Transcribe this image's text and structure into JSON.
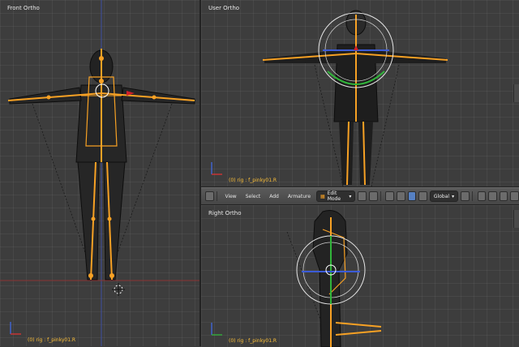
{
  "front": {
    "title": "Front Ortho",
    "status": "(0) rig : f_pinky01.R"
  },
  "user": {
    "title": "User Ortho",
    "status": "(0) rig : f_pinky01.R"
  },
  "right": {
    "title": "Right Ortho",
    "status": "(0) rig : f_pinky01.R"
  },
  "header": {
    "menus": [
      "View",
      "Select",
      "Add",
      "Armature"
    ],
    "mode": "Edit Mode",
    "orientation": "Global"
  },
  "colors": {
    "bone": "#f7a124",
    "wire": "#101010",
    "bg": "#3d3d3d",
    "status": "#ffc23a"
  }
}
